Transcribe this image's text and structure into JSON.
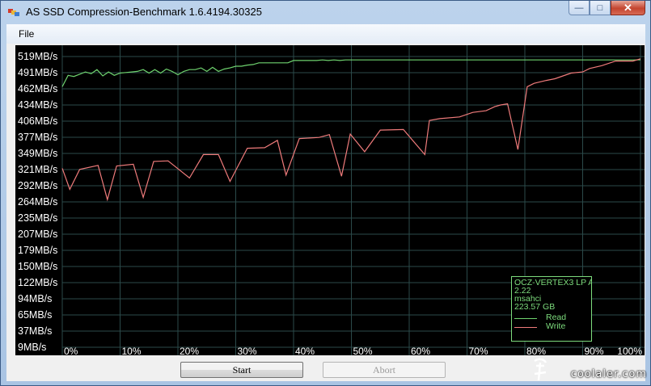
{
  "window": {
    "title": "AS SSD Compression-Benchmark 1.6.4194.30325",
    "buttons": {
      "minimize": "—",
      "maximize": "□",
      "close": "✕"
    }
  },
  "menu": {
    "file": "File"
  },
  "buttons": {
    "start": "Start",
    "abort": "Abort"
  },
  "legend": {
    "device": "OCZ-VERTEX3 LP A",
    "firmware": "2.22",
    "driver": "msahci",
    "capacity": "223.57 GB",
    "read_label": "Read",
    "write_label": "Write"
  },
  "watermark": "coolaler.com",
  "colors": {
    "read": "#6fd36f",
    "write": "#ef7b7b",
    "grid": "#2b4a4a"
  },
  "chart_data": {
    "type": "line",
    "y_ticks": [
      "519MB/s",
      "491MB/s",
      "462MB/s",
      "434MB/s",
      "406MB/s",
      "377MB/s",
      "349MB/s",
      "321MB/s",
      "292MB/s",
      "264MB/s",
      "235MB/s",
      "207MB/s",
      "179MB/s",
      "150MB/s",
      "122MB/s",
      "94MB/s",
      "65MB/s",
      "37MB/s",
      "9MB/s"
    ],
    "x_ticks": [
      "0%",
      "10%",
      "20%",
      "30%",
      "40%",
      "50%",
      "60%",
      "70%",
      "80%",
      "90%",
      "100%"
    ],
    "ylim": [
      9,
      519
    ],
    "xlim": [
      0,
      100
    ],
    "series": [
      {
        "name": "Read",
        "x": [
          0,
          1,
          2,
          3,
          4,
          5,
          6,
          7,
          8,
          9,
          10,
          11,
          12,
          13,
          14,
          15,
          16,
          17,
          18,
          19,
          20,
          21,
          22,
          23,
          24,
          25,
          26,
          27,
          28,
          29,
          30,
          31,
          32,
          33,
          34,
          35,
          36,
          37,
          38,
          39,
          40,
          41,
          42,
          43,
          44,
          45,
          46,
          47,
          48,
          49,
          50,
          51,
          52,
          53,
          54,
          55,
          56,
          57,
          58,
          59,
          60,
          61,
          62,
          63,
          64,
          65,
          66,
          67,
          68,
          69,
          70,
          71,
          72,
          73,
          74,
          75,
          76,
          77,
          78,
          79,
          80,
          81,
          82,
          83,
          84,
          85,
          86,
          87,
          88,
          89,
          90,
          91,
          92,
          93,
          94,
          95,
          96,
          97,
          98,
          99,
          100
        ],
        "values": [
          466,
          486,
          484,
          488,
          492,
          489,
          496,
          485,
          492,
          486,
          490,
          491,
          492,
          493,
          496,
          490,
          496,
          490,
          497,
          493,
          487,
          493,
          496,
          496,
          499,
          493,
          500,
          493,
          497,
          499,
          502,
          502,
          504,
          505,
          508,
          508,
          508,
          508,
          508,
          508,
          512,
          512,
          512,
          512,
          512,
          513,
          512,
          513,
          512,
          513,
          513,
          513,
          513,
          513,
          513,
          513,
          513,
          513,
          513,
          513,
          513,
          513,
          513,
          513,
          513,
          513,
          513,
          513,
          513,
          513,
          513,
          513,
          513,
          513,
          513,
          513,
          513,
          513,
          513,
          513,
          513,
          513,
          513,
          513,
          513,
          513,
          513,
          513,
          513,
          513,
          513,
          513,
          513,
          513,
          513,
          513,
          513,
          513,
          513,
          513,
          513
        ]
      },
      {
        "name": "Write",
        "x": [
          0,
          1.3,
          3,
          6.2,
          7.8,
          9.4,
          12.3,
          14,
          15.8,
          18.3,
          22,
          24.4,
          27,
          29,
          32,
          35,
          37.2,
          38.7,
          41,
          44.4,
          46.2,
          48.3,
          49.8,
          52.3,
          55,
          59,
          62.7,
          63.5,
          65.3,
          68.7,
          71,
          73.3,
          74.8,
          75.8,
          77,
          78.8,
          80.4,
          81.6,
          83.7,
          85.2,
          88,
          90,
          91.2,
          93.3,
          95.7,
          98.7,
          100
        ],
        "values": [
          323,
          286,
          321,
          328,
          268,
          327,
          330,
          272,
          335,
          336,
          306,
          347,
          347,
          300,
          358,
          359,
          372,
          311,
          375,
          377,
          382,
          309,
          383,
          352,
          390,
          391,
          347,
          407,
          410,
          413,
          421,
          424,
          431,
          434,
          436,
          356,
          466,
          472,
          477,
          480,
          490,
          492,
          498,
          503,
          511,
          511,
          515
        ]
      }
    ]
  }
}
